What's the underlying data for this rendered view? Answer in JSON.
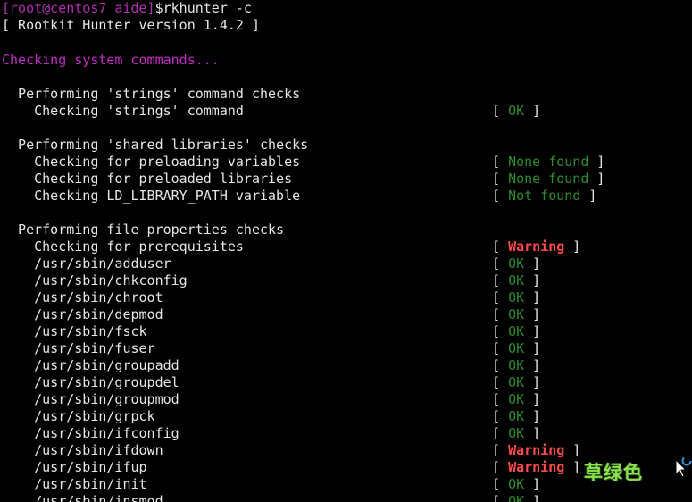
{
  "prompt": {
    "user_host": "[root@centos7 aide]",
    "symbol": "$",
    "command": "rkhunter -c"
  },
  "banner": "[ Rootkit Hunter version 1.4.2 ]",
  "section_title": "Checking system commands...",
  "groups": [
    {
      "title": "Performing 'strings' command checks",
      "checks": [
        {
          "label": "Checking 'strings' command",
          "result": "OK",
          "kind": "ok"
        }
      ]
    },
    {
      "title": "Performing 'shared libraries' checks",
      "checks": [
        {
          "label": "Checking for preloading variables",
          "result": "None found",
          "kind": "nf"
        },
        {
          "label": "Checking for preloaded libraries",
          "result": "None found",
          "kind": "nf"
        },
        {
          "label": "Checking LD_LIBRARY_PATH variable",
          "result": "Not found",
          "kind": "nf"
        }
      ]
    },
    {
      "title": "Performing file properties checks",
      "checks": [
        {
          "label": "Checking for prerequisites",
          "result": "Warning",
          "kind": "warn"
        },
        {
          "label": "/usr/sbin/adduser",
          "result": "OK",
          "kind": "ok"
        },
        {
          "label": "/usr/sbin/chkconfig",
          "result": "OK",
          "kind": "ok"
        },
        {
          "label": "/usr/sbin/chroot",
          "result": "OK",
          "kind": "ok"
        },
        {
          "label": "/usr/sbin/depmod",
          "result": "OK",
          "kind": "ok"
        },
        {
          "label": "/usr/sbin/fsck",
          "result": "OK",
          "kind": "ok"
        },
        {
          "label": "/usr/sbin/fuser",
          "result": "OK",
          "kind": "ok"
        },
        {
          "label": "/usr/sbin/groupadd",
          "result": "OK",
          "kind": "ok"
        },
        {
          "label": "/usr/sbin/groupdel",
          "result": "OK",
          "kind": "ok"
        },
        {
          "label": "/usr/sbin/groupmod",
          "result": "OK",
          "kind": "ok"
        },
        {
          "label": "/usr/sbin/grpck",
          "result": "OK",
          "kind": "ok"
        },
        {
          "label": "/usr/sbin/ifconfig",
          "result": "OK",
          "kind": "ok"
        },
        {
          "label": "/usr/sbin/ifdown",
          "result": "Warning",
          "kind": "warn"
        },
        {
          "label": "/usr/sbin/ifup",
          "result": "Warning",
          "kind": "warn"
        },
        {
          "label": "/usr/sbin/init",
          "result": "OK",
          "kind": "ok"
        },
        {
          "label": "/usr/sbin/insmod",
          "result": "OK",
          "kind": "ok"
        }
      ]
    }
  ],
  "watermark": "草绿色",
  "colors": {
    "background": "#000000",
    "prompt": "#b12fb1",
    "section": "#c22ec2",
    "ok": "#2e8b2e",
    "warning": "#ff4b4b",
    "text": "#e6e6e6"
  },
  "icons": [
    "mouse-cursor-icon",
    "loading-spinner-icon"
  ]
}
